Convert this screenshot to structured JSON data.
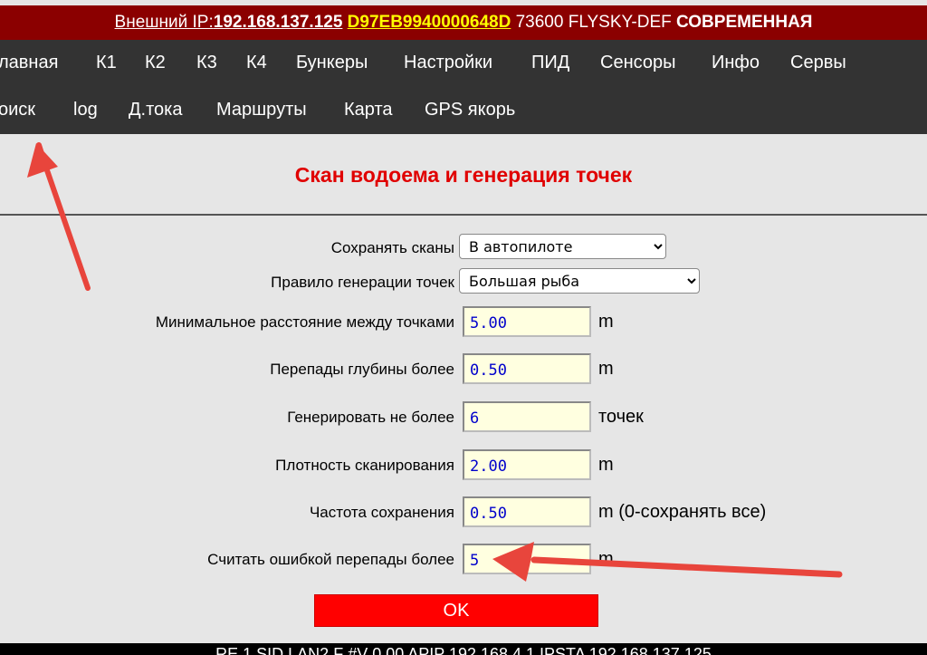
{
  "header": {
    "ip_label": "Внешний IP:",
    "ip_value": "192.168.137.125",
    "device_id": "D97EB9940000648D",
    "code": "73600 FLYSKY-DEF",
    "mode": "СОВРЕМЕННАЯ"
  },
  "nav": {
    "row1": [
      "лавная",
      "К1",
      "К2",
      "К3",
      "К4",
      "Бункеры",
      "Настройки",
      "ПИД",
      "Сенсоры",
      "Инфо",
      "Сервы"
    ],
    "row2": [
      "оиск",
      "log",
      "Д.тока",
      "Маршруты",
      "Карта",
      "GPS якорь"
    ]
  },
  "page": {
    "title": "Скан водоема и генерация точек"
  },
  "form": {
    "save_scans_label": "Сохранять сканы",
    "save_scans_value": "В автопилоте",
    "gen_rule_label": "Правило генерации точек",
    "gen_rule_value": "Большая рыба",
    "min_dist_label": "Минимальное расстояние между точками",
    "min_dist_value": "5.00",
    "min_dist_unit": "m",
    "depth_diff_label": "Перепады глубины более",
    "depth_diff_value": "0.50",
    "depth_diff_unit": "m",
    "gen_max_label": "Генерировать не более",
    "gen_max_value": "6",
    "gen_max_unit": "точек",
    "scan_density_label": "Плотность сканирования",
    "scan_density_value": "2.00",
    "scan_density_unit": "m",
    "save_freq_label": "Частота сохранения",
    "save_freq_value": "0.50",
    "save_freq_unit": "m (0-сохранять все)",
    "error_diff_label": "Считать ошибкой перепады более",
    "error_diff_value": "5",
    "error_diff_unit": "m",
    "ok_label": "OK"
  },
  "footer": {
    "text": "RE 1 SID LAN2 F #V 0.00 APIP 192.168.4.1 IPSTA 192.168.137.125"
  },
  "colors": {
    "header_bg": "#8b0000",
    "nav_bg": "#333333",
    "accent_red": "#ff0000",
    "arrow": "#e8453c"
  }
}
